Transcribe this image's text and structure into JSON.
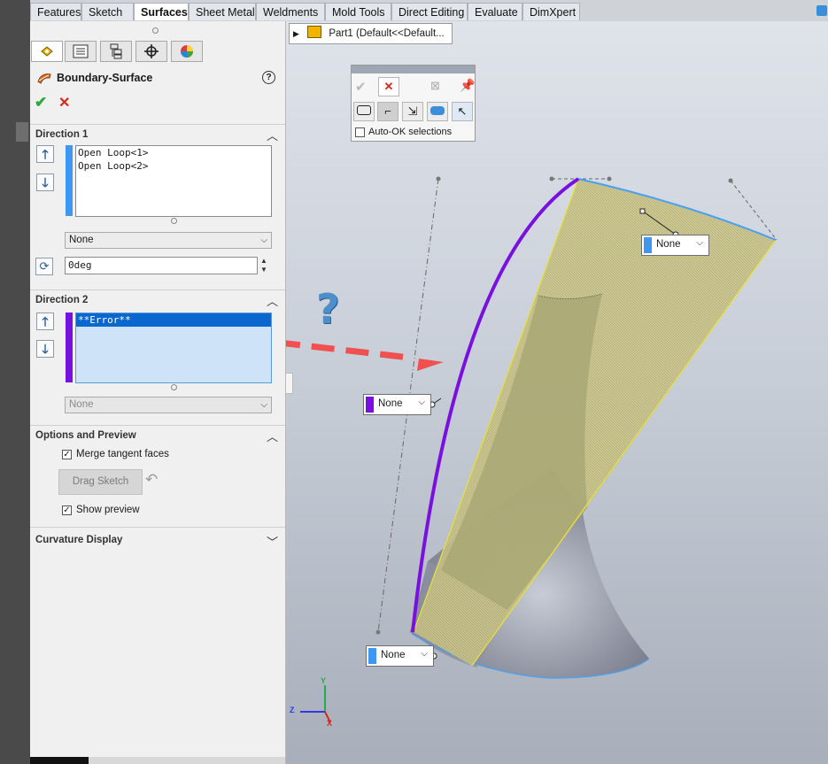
{
  "tabs": [
    "Features",
    "Sketch",
    "Surfaces",
    "Sheet Metal",
    "Weldments",
    "Mold Tools",
    "Direct Editing",
    "Evaluate",
    "DimXpert"
  ],
  "active_tab": "Surfaces",
  "panel": {
    "title": "Boundary-Surface",
    "help": "?",
    "direction1": {
      "header": "Direction 1",
      "items": [
        "Open Loop<1>",
        "Open Loop<2>"
      ],
      "tangency": "None",
      "angle": "0deg"
    },
    "direction2": {
      "header": "Direction 2",
      "items": [
        "**Error**"
      ],
      "tangency": "None"
    },
    "options": {
      "header": "Options and Preview",
      "merge_label": "Merge tangent faces",
      "merge_checked": true,
      "drag_label": "Drag Sketch",
      "preview_label": "Show preview",
      "preview_checked": true
    },
    "curvature": {
      "header": "Curvature Display"
    }
  },
  "tree": {
    "label": "Part1  (Default<<Default..."
  },
  "selection_toolbar": {
    "auto_ok_label": "Auto-OK selections",
    "auto_ok_checked": false
  },
  "callouts": {
    "top_right": "None",
    "mid_left": "None",
    "bottom_left": "None"
  },
  "triad": {
    "y": "Y",
    "z": "Z",
    "x": "X"
  },
  "annotation": {
    "question_mark": "?"
  },
  "colors": {
    "direction1": "#3f97f0",
    "direction2": "#7a10e0",
    "error_highlight": "#0a67d0",
    "surface_preview": "#c9c47a",
    "arrow": "#f05050"
  }
}
